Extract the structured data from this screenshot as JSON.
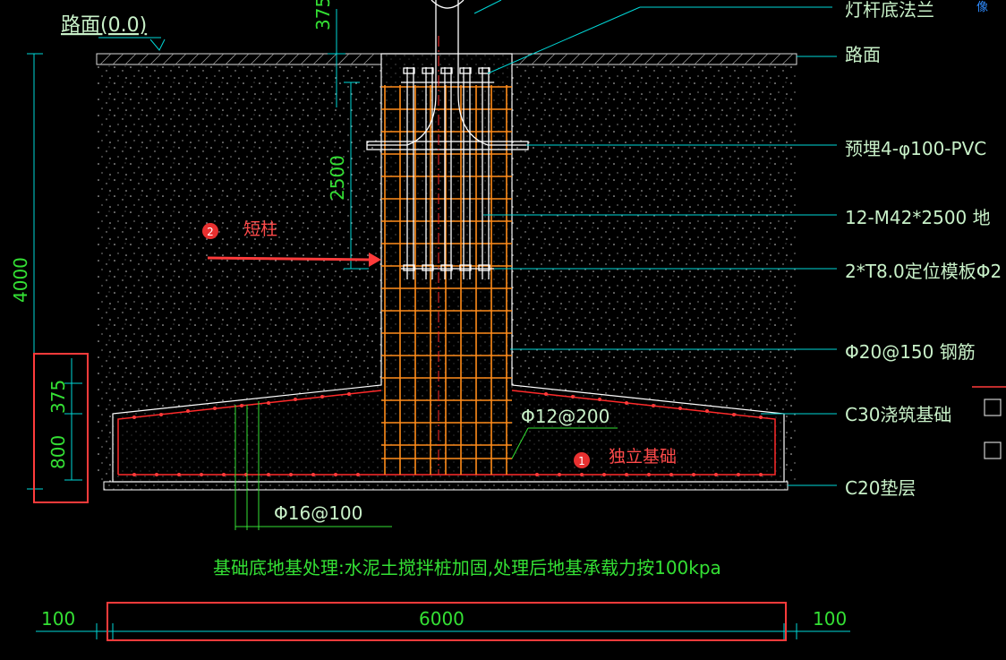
{
  "colors": {
    "background": "#000000",
    "label_text": "#c8f0c8",
    "dimension": "#34e034",
    "leader": "#00e5e5",
    "rebar": "#ff8c1a",
    "annotation_red": "#ff3b3b",
    "concrete_outline": "#ffffff",
    "top_icon": "#2f8cff"
  },
  "top_icon": {
    "text": "像",
    "icon": "image-icon"
  },
  "road_level": {
    "text": "路面(0.0)"
  },
  "dims": {
    "top_375": "375",
    "stub_2500": "2500",
    "total_4000": "4000",
    "box_375": "375",
    "box_800": "800",
    "bottom_left_100": "100",
    "bottom_6000": "6000",
    "bottom_right_100": "100"
  },
  "labels": {
    "flange": "灯杆底法兰",
    "road": "路面",
    "pvc": "预埋4-φ100-PVC",
    "anchor_bolt": "12-M42*2500 地",
    "template": "2*T8.0定位模板Φ2",
    "rebar_20": "Φ20@150 钢筋",
    "c30": "C30浇筑基础",
    "c20": "C20垫层",
    "rebar_12": "Φ12@200",
    "rebar_16": "Φ16@100"
  },
  "annotations": {
    "marker_1": "1",
    "marker_1_text": "独立基础",
    "marker_2": "2",
    "marker_2_text": "短柱"
  },
  "note": "基础底地基处理:水泥土搅拌桩加固,处理后地基承载力按100kpa"
}
